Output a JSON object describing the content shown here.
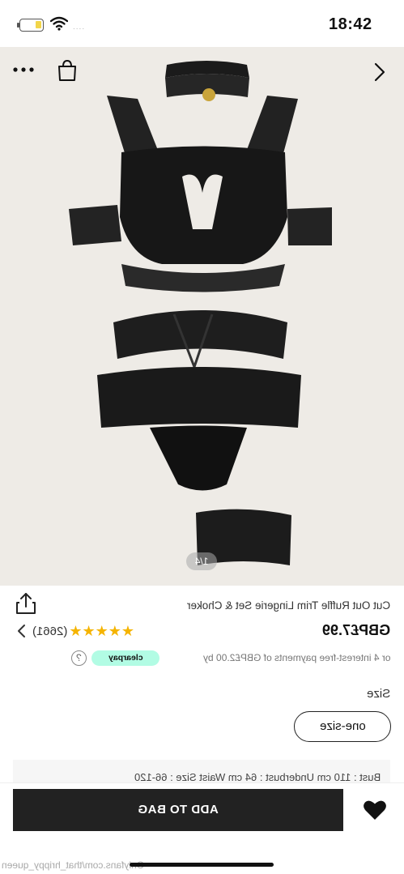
{
  "status_bar": {
    "time": "18:42",
    "signal_dots": "....",
    "battery_icon": "battery-icon",
    "wifi_icon": "wifi-icon"
  },
  "product_image": {
    "counter": "1/4",
    "more_icon": "more-icon",
    "bag_icon": "shopping-bag-icon",
    "next_icon": "chevron-right-icon"
  },
  "product": {
    "title": "Cut Out Ruffle Trim Lingerie Set & Choker",
    "price": "GBP£7.99",
    "rating_count": "(2661)",
    "rating": 5,
    "payment_text": "or 4 interest-free payments of GBP£2.00 by",
    "clearpay_label": "clearpay",
    "help_label": "?"
  },
  "size": {
    "label": "Size",
    "selected": "one-size",
    "measurements": "Bust : 110 cm   Underbust : 64 cm   Waist Size : 66-120"
  },
  "actions": {
    "add_to_bag": "ADD TO BAG",
    "wishlist_icon": "heart-icon"
  },
  "watermark": "Onlyfans.com/that_hrippy_queen",
  "colors": {
    "button_bg": "#222222",
    "clearpay": "#b2fce4",
    "star": "#f5b400",
    "image_bg": "#eeebe6"
  }
}
